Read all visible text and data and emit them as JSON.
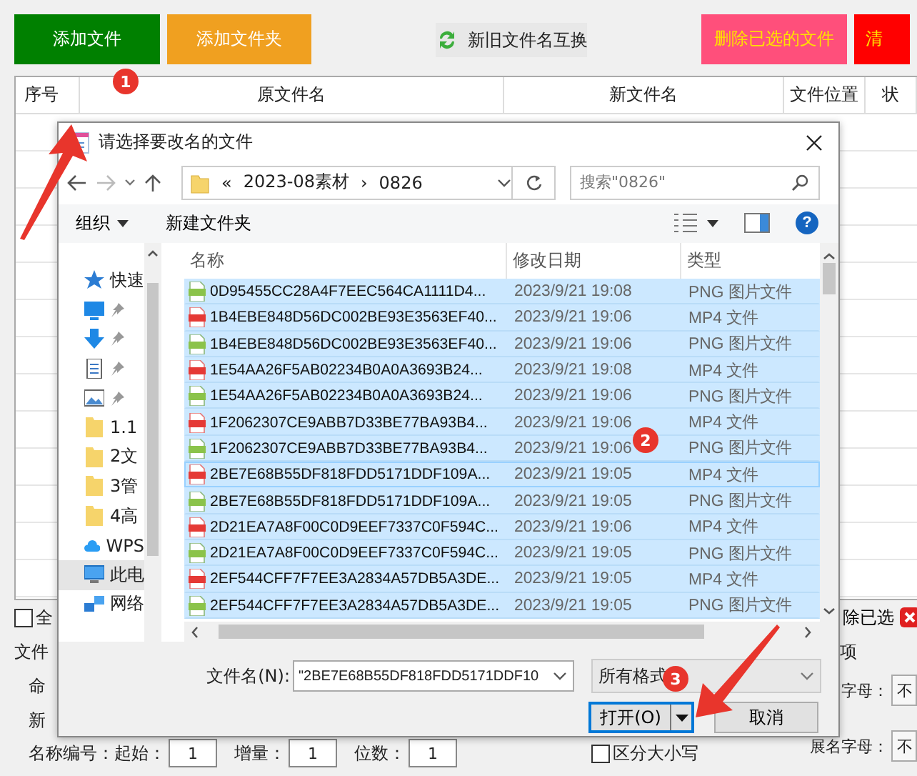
{
  "toolbar": {
    "buttons": [
      {
        "label": "添加文件",
        "kind": "solid",
        "color": "#008000"
      },
      {
        "label": "添加文件夹",
        "kind": "solid",
        "color": "#f0a020"
      },
      {
        "label": "新旧文件名互换",
        "kind": "swap",
        "color": "#e8e8e8"
      },
      {
        "label": "删除已选的文件",
        "kind": "solid",
        "color": "#ff4f7b"
      },
      {
        "label": "清",
        "kind": "solid",
        "color": "#ff0000"
      }
    ]
  },
  "table": {
    "columns": [
      "序号",
      "原文件名",
      "新文件名",
      "文件位置",
      "状"
    ]
  },
  "options": {
    "select_all": {
      "label": "全",
      "checked": false
    },
    "group_label": "文件",
    "naming_label": "命",
    "new_label": "新",
    "numbering": {
      "label": "名称编号：",
      "fields": [
        {
          "label": "起始：",
          "value": "1"
        },
        {
          "label": "增量：",
          "value": "1"
        },
        {
          "label": "位数：",
          "value": "1"
        }
      ]
    },
    "case_sensitive": {
      "label": "区分大小写",
      "checked": false
    },
    "delete_selected": "除已选",
    "section_label": "项",
    "letter_rows": [
      {
        "label": "字母：",
        "value": "不"
      },
      {
        "label": "展名字母：",
        "value": "不"
      }
    ]
  },
  "dialog": {
    "title": "请选择要改名的文件",
    "address": {
      "prefix": "«",
      "segments": [
        "2023-08素材",
        "0826"
      ],
      "separator": "›"
    },
    "search": {
      "placeholder": "搜索\"0826\""
    },
    "commands": [
      "组织",
      "新建文件夹"
    ],
    "help": "?",
    "nav_items": [
      {
        "label": "快速",
        "kind": "star",
        "selected": false
      },
      {
        "kind": "desktop",
        "selected": false
      },
      {
        "kind": "download",
        "selected": false
      },
      {
        "kind": "document",
        "selected": false
      },
      {
        "kind": "image",
        "selected": false
      },
      {
        "label": "1.1",
        "kind": "folder",
        "selected": false
      },
      {
        "label": "2文",
        "kind": "folder",
        "selected": false
      },
      {
        "label": "3管",
        "kind": "folder",
        "selected": false
      },
      {
        "label": "4高",
        "kind": "folder",
        "selected": false
      },
      {
        "label": "WPS",
        "kind": "cloud",
        "selected": false
      },
      {
        "label": "此电",
        "kind": "computer",
        "selected": true
      },
      {
        "label": "网络",
        "kind": "network",
        "selected": false
      }
    ],
    "columns": [
      "名称",
      "修改日期",
      "类型"
    ],
    "files": [
      {
        "name": "0D95455CC28A4F7EEC564CA1111D4...",
        "date": "2023/9/21 19:08",
        "type": "PNG 图片文件",
        "kind": "png",
        "selected": true,
        "focused": false
      },
      {
        "name": "1B4EBE848D56DC002BE93E3563EF40...",
        "date": "2023/9/21 19:06",
        "type": "MP4 文件",
        "kind": "mp4",
        "selected": true,
        "focused": false
      },
      {
        "name": "1B4EBE848D56DC002BE93E3563EF40...",
        "date": "2023/9/21 19:06",
        "type": "PNG 图片文件",
        "kind": "png",
        "selected": true,
        "focused": false
      },
      {
        "name": "1E54AA26F5AB02234B0A0A3693B24...",
        "date": "2023/9/21 19:08",
        "type": "MP4 文件",
        "kind": "mp4",
        "selected": true,
        "focused": false
      },
      {
        "name": "1E54AA26F5AB02234B0A0A3693B24...",
        "date": "2023/9/21 19:06",
        "type": "PNG 图片文件",
        "kind": "png",
        "selected": true,
        "focused": false
      },
      {
        "name": "1F2062307CE9ABB7D33BE77BA93B4...",
        "date": "2023/9/21 19:06",
        "type": "MP4 文件",
        "kind": "mp4",
        "selected": true,
        "focused": false
      },
      {
        "name": "1F2062307CE9ABB7D33BE77BA93B4...",
        "date": "2023/9/21 19:06",
        "type": "PNG 图片文件",
        "kind": "png",
        "selected": true,
        "focused": false
      },
      {
        "name": "2BE7E68B55DF818FDD5171DDF109A...",
        "date": "2023/9/21 19:05",
        "type": "MP4 文件",
        "kind": "mp4",
        "selected": true,
        "focused": true
      },
      {
        "name": "2BE7E68B55DF818FDD5171DDF109A...",
        "date": "2023/9/21 19:05",
        "type": "PNG 图片文件",
        "kind": "png",
        "selected": true,
        "focused": false
      },
      {
        "name": "2D21EA7A8F00C0D9EEF7337C0F594C...",
        "date": "2023/9/21 19:06",
        "type": "MP4 文件",
        "kind": "mp4",
        "selected": true,
        "focused": false
      },
      {
        "name": "2D21EA7A8F00C0D9EEF7337C0F594C...",
        "date": "2023/9/21 19:05",
        "type": "PNG 图片文件",
        "kind": "png",
        "selected": true,
        "focused": false
      },
      {
        "name": "2EF544CFF7F7EE3A2834A57DB5A3DE...",
        "date": "2023/9/21 19:05",
        "type": "MP4 文件",
        "kind": "mp4",
        "selected": true,
        "focused": false
      },
      {
        "name": "2EF544CFF7F7EE3A2834A57DB5A3DE...",
        "date": "2023/9/21 19:05",
        "type": "PNG 图片文件",
        "kind": "png",
        "selected": true,
        "focused": false
      }
    ],
    "filename": {
      "label": "文件名(N):",
      "value": "\"2BE7E68B55DF818FDD5171DDF10"
    },
    "filter": "所有格式",
    "buttons": [
      {
        "label": "打开(O)",
        "kind": "split"
      },
      {
        "label": "取消",
        "kind": "plain"
      }
    ]
  },
  "annotations": [
    {
      "label": "1"
    },
    {
      "label": "2"
    },
    {
      "label": "3"
    }
  ]
}
